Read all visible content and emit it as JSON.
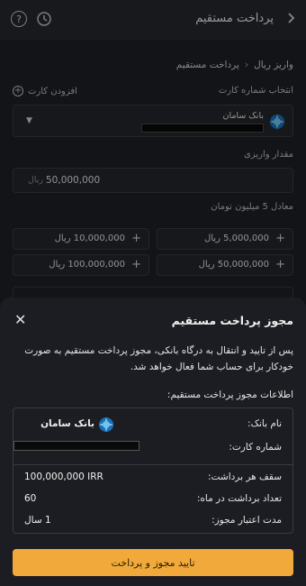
{
  "header": {
    "title": "پرداخت مستقیم",
    "back_glyph": "‹",
    "help_glyph": "?"
  },
  "breadcrumb": {
    "parent": "واریز ریال",
    "separator": "‹",
    "current": "پرداخت مستقیم"
  },
  "card_section": {
    "label": "انتخاب شماره کارت",
    "add_label": "افزودن کارت",
    "bank_name": "بانک سامان"
  },
  "amount_section": {
    "label": "مقدار واریزی",
    "value": "50,000,000",
    "unit": "ریال",
    "equivalent": "معادل 5 میلیون تومان"
  },
  "quick_amounts": [
    {
      "label": "5,000,000 ریال"
    },
    {
      "label": "10,000,000 ریال"
    },
    {
      "label": "50,000,000 ریال"
    },
    {
      "label": "100,000,000 ریال"
    }
  ],
  "sheet": {
    "title": "مجوز پرداخت مستقیم",
    "description": "پس از تایید و انتقال به درگاه بانکی، مجوز پرداخت مستقیم به صورت خودکار برای حساب شما فعال خواهد شد.",
    "info_title": "اطلاعات مجوز پرداخت مستقیم:",
    "bank_label": "نام بانک:",
    "bank_value": "بانک سامان",
    "card_label": "شماره کارت:",
    "limit_label": "سقف هر برداشت:",
    "limit_value": "100,000,000 IRR",
    "count_label": "تعداد برداشت در ماه:",
    "count_value": "60",
    "validity_label": "مدت اعتبار مجوز:",
    "validity_value": "1 سال",
    "confirm_label": "تایید مجوز و پرداخت",
    "close_glyph": "✕"
  },
  "colors": {
    "accent": "#f0a93a",
    "background": "#1c1d22",
    "border": "#3a3b40"
  }
}
